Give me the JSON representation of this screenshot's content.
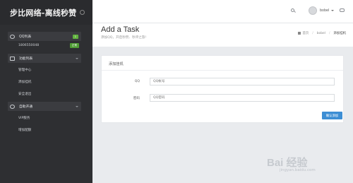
{
  "sidebar": {
    "brand_title": "步比网络-离线秒赞",
    "sections": [
      {
        "label": "QQ列表",
        "badge": "1"
      },
      {
        "label": "功能列表"
      },
      {
        "label": "自助开通"
      }
    ],
    "qq_item": {
      "label": "1806550048",
      "badge": "正常"
    },
    "function_items": [
      "管理中心",
      "添加挂机",
      "安全退出"
    ],
    "selfservice_items": [
      "VIP服务",
      "增加配额"
    ]
  },
  "topbar": {
    "username": "bobel",
    "icons": [
      "search-icon",
      "avatar",
      "chat-icon"
    ]
  },
  "header": {
    "title": "Add a Task",
    "subtitle": "添加QQ，开启秒赞、秒评之旅!",
    "breadcrumb": [
      "首页",
      "bobel",
      "添加挂机"
    ]
  },
  "form": {
    "card_title": "添加挂机",
    "qq_label": "QQ",
    "qq_placeholder": "QQ帐号",
    "pwd_label": "密码",
    "pwd_placeholder": "QQ密码",
    "submit_label": "确认添加"
  },
  "watermark": {
    "text": "Bai 经验",
    "sub": "jingyan.baidu.com"
  },
  "colors": {
    "sidebar_bg": "#2e2f32",
    "accent_blue": "#3d8ed4",
    "badge_green": "#62b33f"
  }
}
